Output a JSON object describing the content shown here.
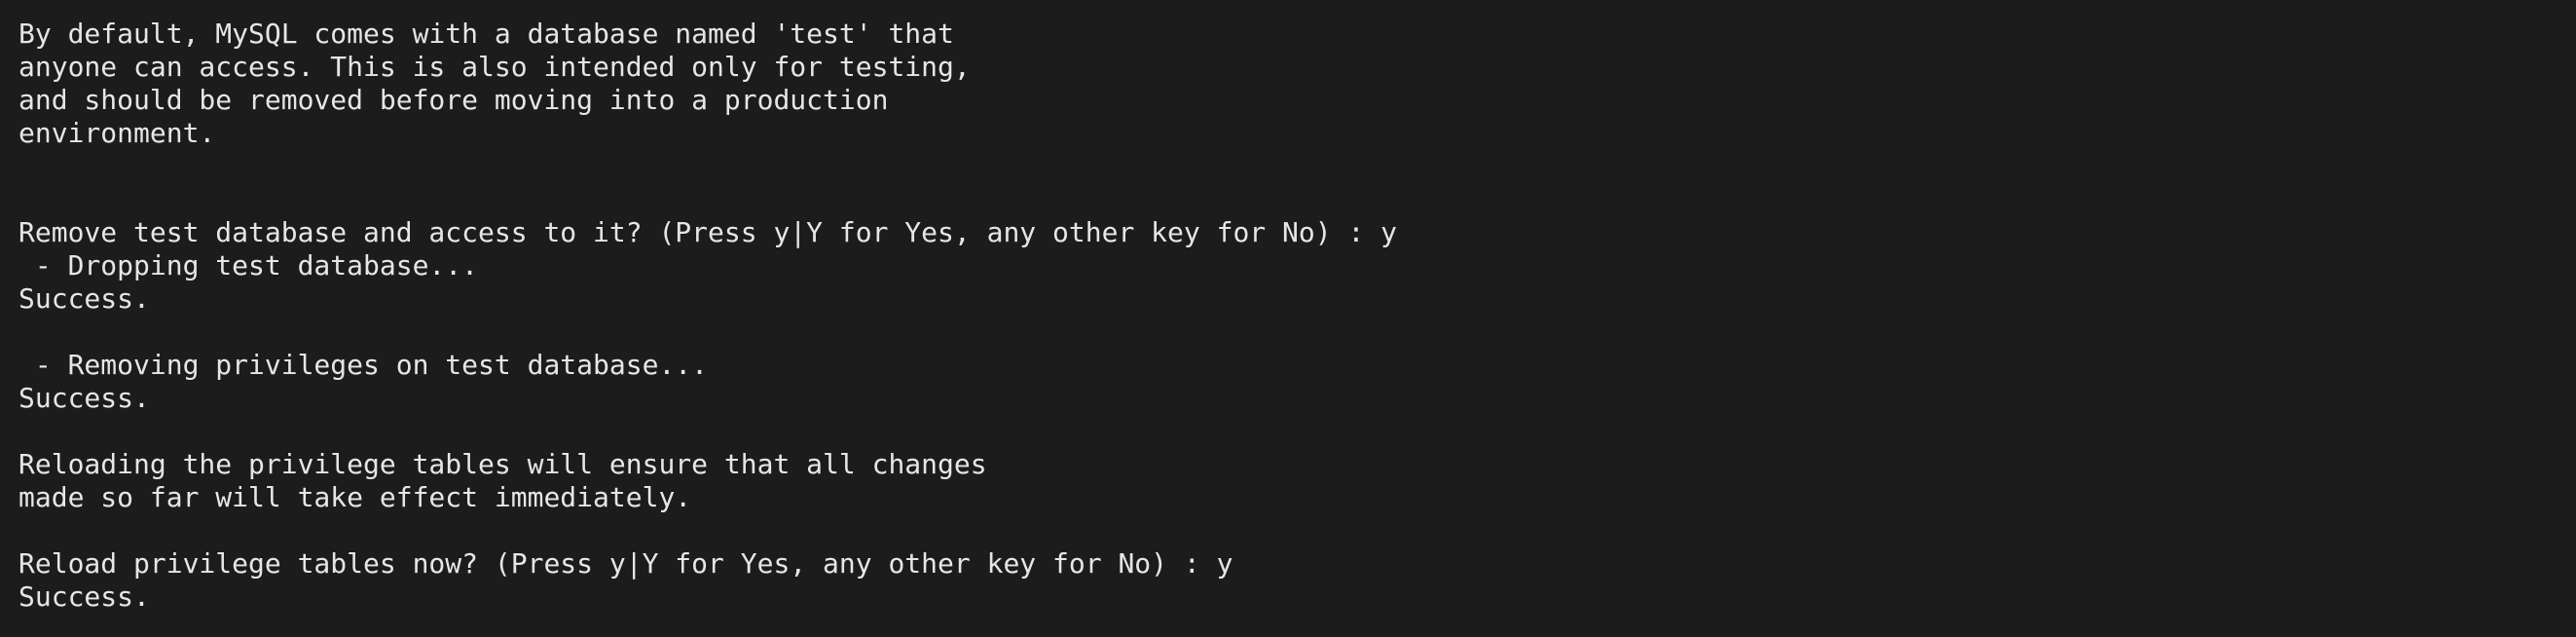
{
  "terminal": {
    "lines": [
      "By default, MySQL comes with a database named 'test' that",
      "anyone can access. This is also intended only for testing,",
      "and should be removed before moving into a production",
      "environment.",
      "",
      "",
      "Remove test database and access to it? (Press y|Y for Yes, any other key for No) : y",
      " - Dropping test database...",
      "Success.",
      "",
      " - Removing privileges on test database...",
      "Success.",
      "",
      "Reloading the privilege tables will ensure that all changes",
      "made so far will take effect immediately.",
      "",
      "Reload privilege tables now? (Press y|Y for Yes, any other key for No) : y",
      "Success."
    ]
  }
}
